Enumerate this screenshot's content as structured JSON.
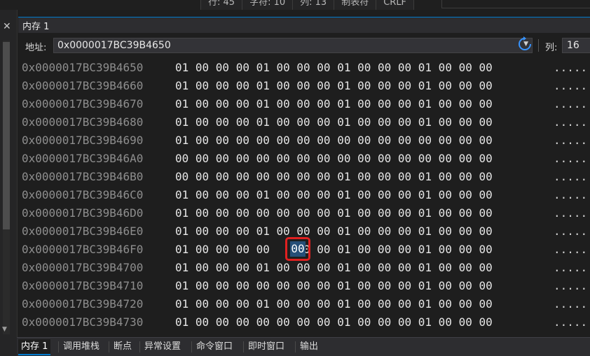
{
  "status": {
    "line": "行: 45",
    "char": "字符: 10",
    "col": "列: 13",
    "tab": "制表符",
    "eol": "CRLF"
  },
  "left": {
    "close_glyph": "✕"
  },
  "panel": {
    "title": "内存 1",
    "address_label": "地址:",
    "address_value": "0x0000017BC39B4650",
    "columns_label": "列:",
    "columns_value": "16"
  },
  "memory": {
    "rows": [
      {
        "addr": "0x0000017BC39B4650",
        "bytes": "01 00 00 00 01 00 00 00 01 00 00 00 01 00 00 00",
        "ascii": "....."
      },
      {
        "addr": "0x0000017BC39B4660",
        "bytes": "01 00 00 00 01 00 00 00 01 00 00 00 01 00 00 00",
        "ascii": "....."
      },
      {
        "addr": "0x0000017BC39B4670",
        "bytes": "01 00 00 00 01 00 00 00 01 00 00 00 01 00 00 00",
        "ascii": "....."
      },
      {
        "addr": "0x0000017BC39B4680",
        "bytes": "01 00 00 00 01 00 00 00 01 00 00 00 01 00 00 00",
        "ascii": "....."
      },
      {
        "addr": "0x0000017BC39B4690",
        "bytes": "01 00 00 00 00 00 00 00 00 00 00 00 00 00 00 00",
        "ascii": "....."
      },
      {
        "addr": "0x0000017BC39B46A0",
        "bytes": "00 00 00 00 00 00 00 00 00 00 00 00 00 00 00 00",
        "ascii": "....."
      },
      {
        "addr": "0x0000017BC39B46B0",
        "bytes": "00 00 00 00 00 00 00 00 01 00 00 00 01 00 00 00",
        "ascii": "....."
      },
      {
        "addr": "0x0000017BC39B46C0",
        "bytes": "01 00 00 00 01 00 00 00 01 00 00 00 01 00 00 00",
        "ascii": "....."
      },
      {
        "addr": "0x0000017BC39B46D0",
        "bytes": "01 00 00 00 00 00 00 00 01 00 00 00 01 00 00 00",
        "ascii": "....."
      },
      {
        "addr": "0x0000017BC39B46E0",
        "bytes": "01 00 00 00 01 00 00 00 01 00 00 00 01 00 00 00",
        "ascii": "....."
      },
      {
        "addr": "0x0000017BC39B46F0",
        "bytes": "01 00 00 00 00    00 00 01 00 00 00 01 00 00 00",
        "ascii": "....."
      },
      {
        "addr": "0x0000017BC39B4700",
        "bytes": "01 00 00 00 01 00 00 00 01 00 00 00 01 00 00 00",
        "ascii": "....."
      },
      {
        "addr": "0x0000017BC39B4710",
        "bytes": "01 00 00 00 00 00 00 00 01 00 00 00 01 00 00 00",
        "ascii": "....."
      },
      {
        "addr": "0x0000017BC39B4720",
        "bytes": "01 00 00 00 01 00 00 00 01 00 00 00 01 00 00 00",
        "ascii": "....."
      },
      {
        "addr": "0x0000017BC39B4730",
        "bytes": "01 00 00 00 00 00 00 00 01 00 00 00 01 00 00 00",
        "ascii": "....."
      }
    ],
    "selected_byte": "00"
  },
  "bottom_tabs": [
    "内存 1",
    "调用堆栈",
    "断点",
    "异常设置",
    "命令窗口",
    "即时窗口",
    "输出"
  ],
  "colors": {
    "accent": "#007acc",
    "selection": "#264f78",
    "highlight": "#e02020"
  }
}
